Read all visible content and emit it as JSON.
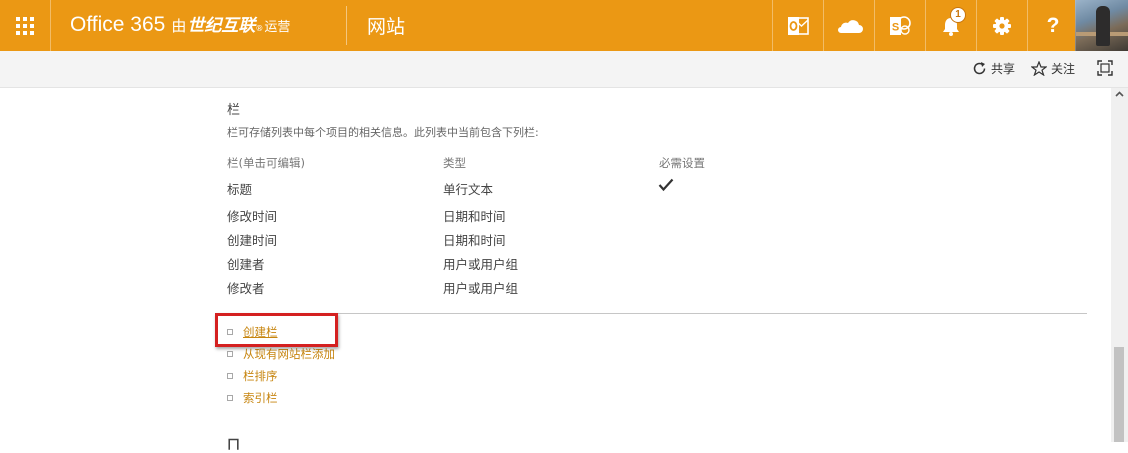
{
  "suitebar": {
    "brand_office": "Office 365",
    "brand_by": "由",
    "brand_partner": "世纪互联",
    "brand_registered": "®",
    "brand_operate": "运营",
    "site_title": "网站",
    "notification_count": "1",
    "help_symbol": "?",
    "icons": [
      "app-launcher-icon",
      "outlook-icon",
      "onedrive-icon",
      "sharepoint-icon",
      "bell-icon",
      "gear-icon",
      "help-icon",
      "avatar"
    ],
    "color": "#eb9814"
  },
  "actionbar": {
    "share_label": "共享",
    "follow_label": "关注"
  },
  "columns_section": {
    "title": "栏",
    "description": "栏可存储列表中每个项目的相关信息。此列表中当前包含下列栏:",
    "headers": {
      "name": "栏(单击可编辑)",
      "type": "类型",
      "required": "必需设置"
    },
    "rows": [
      {
        "name": "标题",
        "type": "单行文本",
        "required": true
      },
      {
        "name": "修改时间",
        "type": "日期和时间",
        "required": false
      },
      {
        "name": "创建时间",
        "type": "日期和时间",
        "required": false
      },
      {
        "name": "创建者",
        "type": "用户或用户组",
        "required": false
      },
      {
        "name": "修改者",
        "type": "用户或用户组",
        "required": false
      }
    ],
    "links": [
      "创建栏",
      "从现有网站栏添加",
      "栏排序",
      "索引栏"
    ]
  },
  "next_section": {
    "title_fragment": "ㄇ"
  },
  "colors": {
    "link": "#c7850f",
    "highlight_box": "#d42020"
  }
}
